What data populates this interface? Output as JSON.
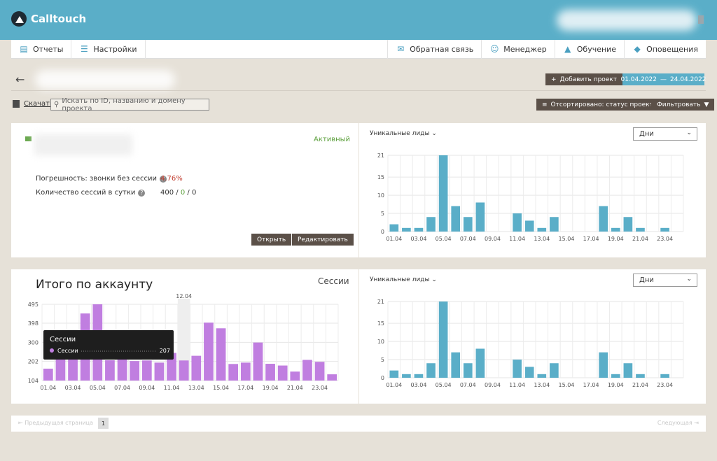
{
  "app": {
    "name": "Calltouch"
  },
  "nav": {
    "left": [
      {
        "label": "Отчеты",
        "icon": "clipboard-icon"
      },
      {
        "label": "Настройки",
        "icon": "sliders-icon"
      }
    ],
    "right": [
      {
        "label": "Обратная связь",
        "icon": "chat-icon"
      },
      {
        "label": "Менеджер",
        "icon": "headset-icon"
      },
      {
        "label": "Обучение",
        "icon": "graduation-cap-icon"
      },
      {
        "label": "Оповещения",
        "icon": "bell-icon"
      }
    ]
  },
  "toolbar": {
    "add_project": "Добавить проект",
    "date_from": "01.04.2022",
    "date_sep": "—",
    "date_to": "24.04.2022",
    "download": "Скачать",
    "search_placeholder": "Искать по ID, названию и домену проекта",
    "sorted": "Отсортировано: статус проекта",
    "filter": "Фильтровать"
  },
  "project": {
    "status": "Активный",
    "metric1_label": "Погрешность: звонки без сессии",
    "metric1_value": "4.76%",
    "metric2_label": "Количество сессий в сутки",
    "metric2_v1": "400",
    "metric2_v2": "0",
    "metric2_v3": "0",
    "sep": "/",
    "open": "Открыть",
    "edit": "Редактировать"
  },
  "account": {
    "title": "Итого по аккаунту",
    "metric": "Сессии",
    "tooltip_title": "Сессии",
    "tooltip_row": "Сессии",
    "tooltip_value": "207",
    "hover_date": "12.04"
  },
  "chart_controls": {
    "metric": "Уникальные лиды",
    "period": "Дни"
  },
  "chart_data": [
    {
      "type": "bar",
      "categories": [
        "01.04",
        "02.04",
        "03.04",
        "04.04",
        "05.04",
        "06.04",
        "07.04",
        "08.04",
        "09.04",
        "10.04",
        "11.04",
        "12.04",
        "13.04",
        "14.04",
        "15.04",
        "16.04",
        "17.04",
        "18.04",
        "19.04",
        "20.04",
        "21.04",
        "22.04",
        "23.04",
        "24.04"
      ],
      "values": [
        2,
        1,
        1,
        4,
        21,
        7,
        4,
        8,
        0,
        0,
        5,
        3,
        1,
        4,
        0,
        0,
        0,
        7,
        1,
        4,
        1,
        0,
        1,
        0
      ],
      "ylim": [
        0,
        21
      ],
      "yticks": [
        0,
        5,
        10,
        15,
        21
      ],
      "xticks": [
        "01.04",
        "03.04",
        "05.04",
        "07.04",
        "09.04",
        "11.04",
        "13.04",
        "15.04",
        "17.04",
        "19.04",
        "21.04",
        "23.04"
      ],
      "color": "#5aaec8",
      "grid": true
    },
    {
      "type": "bar",
      "categories": [
        "01.04",
        "02.04",
        "03.04",
        "04.04",
        "05.04",
        "06.04",
        "07.04",
        "08.04",
        "09.04",
        "10.04",
        "11.04",
        "12.04",
        "13.04",
        "14.04",
        "15.04",
        "16.04",
        "17.04",
        "18.04",
        "19.04",
        "20.04",
        "21.04",
        "22.04",
        "23.04",
        "24.04"
      ],
      "values": [
        165,
        234,
        214,
        448,
        495,
        208,
        219,
        204,
        207,
        196,
        246,
        207,
        231,
        401,
        372,
        189,
        196,
        299,
        190,
        181,
        150,
        210,
        200,
        136
      ],
      "ylim": [
        104,
        495
      ],
      "yticks": [
        104,
        202,
        300,
        398,
        495
      ],
      "xticks": [
        "01.04",
        "03.04",
        "05.04",
        "07.04",
        "09.04",
        "11.04",
        "13.04",
        "15.04",
        "17.04",
        "19.04",
        "21.04",
        "23.04"
      ],
      "color": "#c07ee0",
      "grid": true
    },
    {
      "type": "bar",
      "categories": [
        "01.04",
        "02.04",
        "03.04",
        "04.04",
        "05.04",
        "06.04",
        "07.04",
        "08.04",
        "09.04",
        "10.04",
        "11.04",
        "12.04",
        "13.04",
        "14.04",
        "15.04",
        "16.04",
        "17.04",
        "18.04",
        "19.04",
        "20.04",
        "21.04",
        "22.04",
        "23.04",
        "24.04"
      ],
      "values": [
        2,
        1,
        1,
        4,
        21,
        7,
        4,
        8,
        0,
        0,
        5,
        3,
        1,
        4,
        0,
        0,
        0,
        7,
        1,
        4,
        1,
        0,
        1,
        0
      ],
      "ylim": [
        0,
        21
      ],
      "yticks": [
        0,
        5,
        10,
        15,
        21
      ],
      "xticks": [
        "01.04",
        "03.04",
        "05.04",
        "07.04",
        "09.04",
        "11.04",
        "13.04",
        "15.04",
        "17.04",
        "19.04",
        "21.04",
        "23.04"
      ],
      "color": "#5aaec8",
      "grid": true
    }
  ],
  "pagination": {
    "prev": "Предыдущая страница",
    "current": "1",
    "next": "Следующая"
  },
  "colors": {
    "header": "#5aaec8",
    "accent": "#5aaec8",
    "button_dark": "#5b5048",
    "active": "#5b9f3b",
    "error": "#c0392b",
    "sessions": "#c07ee0"
  }
}
